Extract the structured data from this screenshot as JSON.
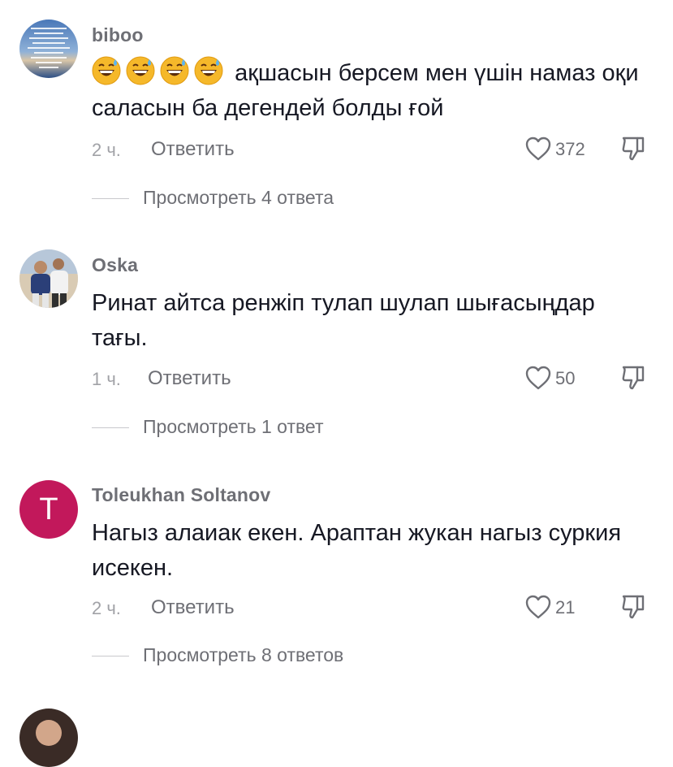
{
  "colors": {
    "text": "#161823",
    "secondary": "#6e6f75",
    "muted": "#a1a2a7",
    "avatar_t": "#c2185b"
  },
  "comments": [
    {
      "username": "biboo",
      "emoji_count": 4,
      "emoji_icon": "grinning-sweat-emoji",
      "text": "ақшасын берсем мен үшін намаз оқи саласын ба дегендей болды ғой",
      "time": "2 ч.",
      "reply_label": "Ответить",
      "likes": "372",
      "replies_label": "Просмотреть 4 ответа"
    },
    {
      "username": "Oska",
      "text": "Ринат айтса ренжіп тулап шулап шығасыңдар тағы.",
      "time": "1 ч.",
      "reply_label": "Ответить",
      "likes": "50",
      "replies_label": "Просмотреть 1 ответ"
    },
    {
      "username": "Toleukhan Soltanov",
      "avatar_initial": "T",
      "text": "Нагыз алаиак екен. Араптан жукан нагыз суркия исекен.",
      "time": "2 ч.",
      "reply_label": "Ответить",
      "likes": "21",
      "replies_label": "Просмотреть 8 ответов"
    }
  ]
}
